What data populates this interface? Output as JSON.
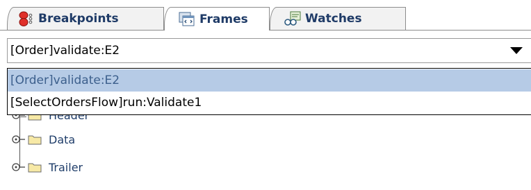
{
  "tabs": [
    {
      "label": "Breakpoints",
      "icon": "breakpoints-icon",
      "active": false
    },
    {
      "label": "Frames",
      "icon": "frames-icon",
      "active": true
    },
    {
      "label": "Watches",
      "icon": "watches-icon",
      "active": false
    }
  ],
  "frame_select": {
    "value": "[Order]validate:E2",
    "options": [
      "[Order]validate:E2",
      "[SelectOrdersFlow]run:Validate1"
    ],
    "selected_index": 0
  },
  "tree": {
    "items": [
      {
        "label": "Header"
      },
      {
        "label": "Data"
      },
      {
        "label": "Trailer"
      }
    ]
  },
  "colors": {
    "tab_text": "#1f3b67",
    "selected_option_bg": "#b6cbe6",
    "selected_option_text": "#3c5f8c",
    "tree_text": "#203e6a",
    "folder_fill": "#f7e9a6"
  }
}
